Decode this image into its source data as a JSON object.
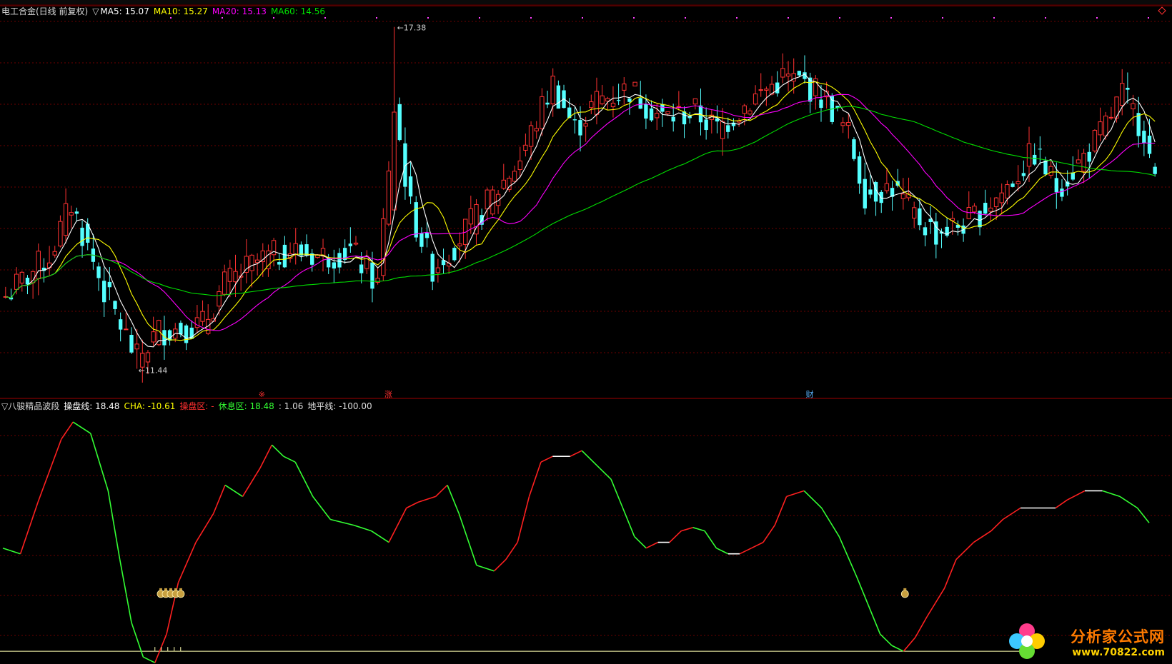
{
  "main_legend": {
    "title": "电工合金(日线 前复权)",
    "marker": "▽",
    "ma5": "MA5: 15.07",
    "ma10": "MA10: 15.27",
    "ma20": "MA20: 15.13",
    "ma60": "MA60: 14.56"
  },
  "indicator_legend": {
    "title": "▽八骏精品波段",
    "line1": "操盘线: 18.48",
    "cha": "CHA: -10.61",
    "zone_op": "操盘区: -",
    "zone_rest": "休息区: 18.48",
    "ratio": ": 1.06",
    "ground": "地平线: -100.00"
  },
  "annotations": {
    "high": "17.38",
    "low": "11.44",
    "event_red1": "※",
    "event_red2": "涨",
    "event_blue": "财"
  },
  "colors": {
    "up": "#ff3232",
    "down": "#54ffff",
    "ma5": "#ffffff",
    "ma10": "#ffff00",
    "ma20": "#ff00ff",
    "ma60": "#00e000",
    "grid": "#6e0000",
    "osc_up": "#ff2020",
    "osc_down": "#33ff33",
    "ground": "#ffffb0"
  },
  "watermark": {
    "title": "分析家公式网",
    "url": "www.70822.com"
  },
  "chart_data": [
    {
      "type": "candlestick",
      "title": "电工合金(日线 前复权)",
      "ylim": [
        11.0,
        17.6
      ],
      "high_label": 17.38,
      "low_label": 11.44,
      "close_keypoints": [
        [
          0,
          12.7
        ],
        [
          8,
          13.4
        ],
        [
          12,
          14.3
        ],
        [
          18,
          12.8
        ],
        [
          24,
          11.6
        ],
        [
          28,
          12.1
        ],
        [
          36,
          12.2
        ],
        [
          40,
          12.9
        ],
        [
          46,
          13.3
        ],
        [
          52,
          13.5
        ],
        [
          58,
          13.4
        ],
        [
          63,
          13.5
        ],
        [
          68,
          12.9
        ],
        [
          71,
          16.0
        ],
        [
          74,
          14.2
        ],
        [
          78,
          13.2
        ],
        [
          82,
          13.6
        ],
        [
          88,
          14.3
        ],
        [
          94,
          15.1
        ],
        [
          100,
          16.4
        ],
        [
          104,
          15.6
        ],
        [
          108,
          16.1
        ],
        [
          114,
          16.3
        ],
        [
          120,
          15.8
        ],
        [
          126,
          15.9
        ],
        [
          130,
          15.6
        ],
        [
          136,
          16.1
        ],
        [
          142,
          16.5
        ],
        [
          146,
          16.4
        ],
        [
          150,
          16.1
        ],
        [
          154,
          15.5
        ],
        [
          157,
          14.5
        ],
        [
          162,
          14.6
        ],
        [
          166,
          14.1
        ],
        [
          170,
          13.8
        ],
        [
          176,
          14.0
        ],
        [
          182,
          14.5
        ],
        [
          188,
          15.2
        ],
        [
          192,
          14.6
        ],
        [
          196,
          15.0
        ],
        [
          200,
          15.5
        ],
        [
          204,
          16.2
        ],
        [
          208,
          15.6
        ],
        [
          210,
          14.6
        ]
      ],
      "series": [
        {
          "name": "MA5",
          "value": 15.07
        },
        {
          "name": "MA10",
          "value": 15.27
        },
        {
          "name": "MA20",
          "value": 15.13
        },
        {
          "name": "MA60",
          "value": 14.56
        }
      ]
    },
    {
      "type": "line",
      "title": "▽八骏精品波段",
      "ylim": [
        -108,
        110
      ],
      "ground_line": -100,
      "points": [
        [
          0,
          -10
        ],
        [
          3,
          -15
        ],
        [
          6,
          30
        ],
        [
          10,
          85
        ],
        [
          12,
          100
        ],
        [
          15,
          90
        ],
        [
          18,
          40
        ],
        [
          20,
          -20
        ],
        [
          22,
          -75
        ],
        [
          24,
          -105
        ],
        [
          26,
          -110
        ],
        [
          28,
          -85
        ],
        [
          30,
          -40
        ],
        [
          33,
          -5
        ],
        [
          36,
          20
        ],
        [
          38,
          45
        ],
        [
          41,
          35
        ],
        [
          44,
          60
        ],
        [
          46,
          80
        ],
        [
          48,
          70
        ],
        [
          50,
          65
        ],
        [
          53,
          35
        ],
        [
          56,
          15
        ],
        [
          60,
          10
        ],
        [
          63,
          5
        ],
        [
          66,
          -5
        ],
        [
          69,
          25
        ],
        [
          71,
          30
        ],
        [
          74,
          35
        ],
        [
          76,
          45
        ],
        [
          78,
          20
        ],
        [
          81,
          -25
        ],
        [
          84,
          -30
        ],
        [
          86,
          -20
        ],
        [
          88,
          -5
        ],
        [
          90,
          35
        ],
        [
          92,
          65
        ],
        [
          94,
          70
        ],
        [
          97,
          70
        ],
        [
          99,
          75
        ],
        [
          102,
          60
        ],
        [
          104,
          50
        ],
        [
          106,
          25
        ],
        [
          108,
          0
        ],
        [
          110,
          -10
        ],
        [
          112,
          -5
        ],
        [
          114,
          -5
        ],
        [
          116,
          5
        ],
        [
          118,
          8
        ],
        [
          120,
          5
        ],
        [
          122,
          -10
        ],
        [
          124,
          -15
        ],
        [
          126,
          -15
        ],
        [
          128,
          -10
        ],
        [
          130,
          -5
        ],
        [
          132,
          10
        ],
        [
          134,
          35
        ],
        [
          137,
          40
        ],
        [
          140,
          25
        ],
        [
          143,
          0
        ],
        [
          146,
          -35
        ],
        [
          148,
          -60
        ],
        [
          150,
          -85
        ],
        [
          152,
          -95
        ],
        [
          154,
          -100
        ],
        [
          156,
          -88
        ],
        [
          158,
          -70
        ],
        [
          161,
          -45
        ],
        [
          163,
          -20
        ],
        [
          166,
          -5
        ],
        [
          169,
          5
        ],
        [
          171,
          15
        ],
        [
          174,
          25
        ],
        [
          177,
          25
        ],
        [
          180,
          25
        ],
        [
          182,
          32
        ],
        [
          185,
          40
        ],
        [
          188,
          40
        ],
        [
          191,
          35
        ],
        [
          194,
          25
        ],
        [
          196,
          12
        ]
      ]
    }
  ]
}
